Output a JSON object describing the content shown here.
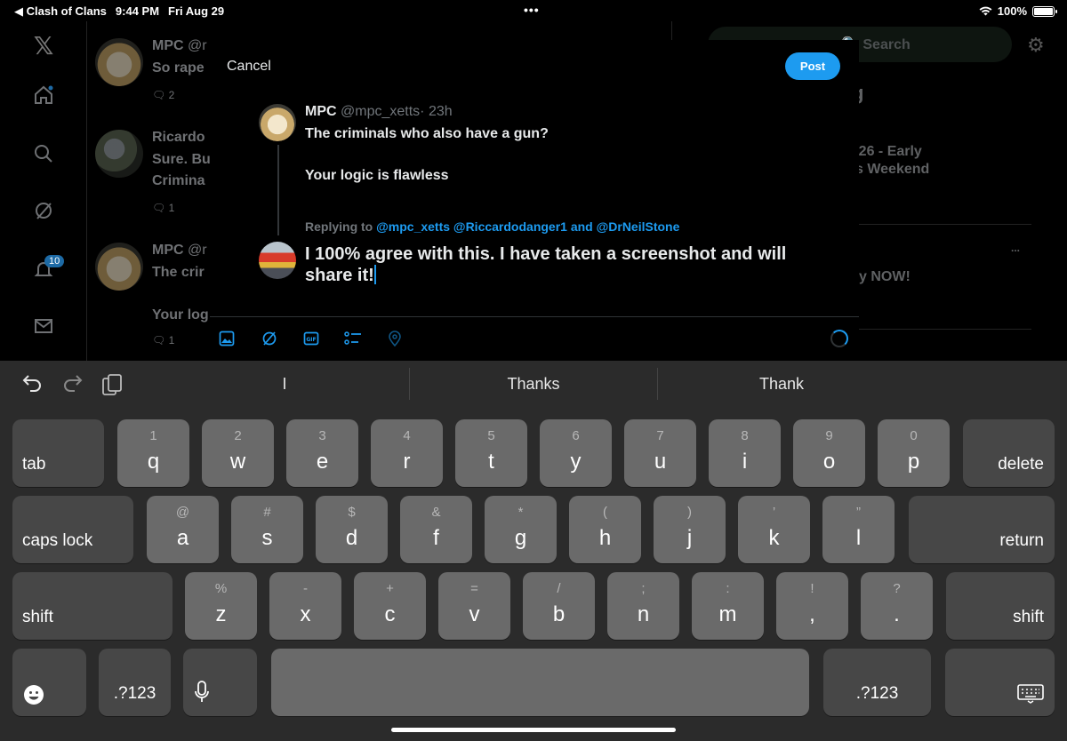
{
  "status_bar": {
    "back_app": "◀ Clash of Clans",
    "time": "9:44 PM",
    "date": "Fri Aug 29",
    "battery_percent": "100%",
    "battery_level": 1.0
  },
  "background": {
    "nav_badge": "10",
    "feed": [
      {
        "name": "MPC",
        "handle": "@r",
        "text": "So rape",
        "reply_count": "2"
      },
      {
        "name": "Ricardo",
        "text_lines": [
          "Sure. Bu",
          "Crimina"
        ],
        "reply_count": "1"
      },
      {
        "name": "MPC",
        "handle": "@r",
        "text_lines": [
          "The crir",
          "Your log"
        ],
        "reply_count": "1"
      }
    ],
    "search_placeholder": "Search",
    "right_snippets": [
      "g",
      "X26 - Early",
      "s Weekend",
      "y NOW!",
      "..."
    ]
  },
  "compose": {
    "cancel_label": "Cancel",
    "post_label": "Post",
    "original": {
      "name": "MPC",
      "handle": "@mpc_xetts",
      "time": "· 23h",
      "line1": "The criminals who also have a gun?",
      "line2": "Your logic is flawless"
    },
    "replying_to_label": "Replying to",
    "replying_to_mentions": "@mpc_xetts @Riccardodanger1 and @DrNeilStone",
    "draft_text": "I 100% agree with this.  I have taken a screenshot and will share it!",
    "toolbar_icons": [
      "image-icon",
      "gif-icon",
      "poll-icon",
      "location-icon",
      "grok-icon"
    ]
  },
  "keyboard": {
    "suggestions": [
      "I",
      "Thanks",
      "Thank"
    ],
    "row1": [
      {
        "sub": "1",
        "main": "q"
      },
      {
        "sub": "2",
        "main": "w"
      },
      {
        "sub": "3",
        "main": "e"
      },
      {
        "sub": "4",
        "main": "r"
      },
      {
        "sub": "5",
        "main": "t"
      },
      {
        "sub": "6",
        "main": "y"
      },
      {
        "sub": "7",
        "main": "u"
      },
      {
        "sub": "8",
        "main": "i"
      },
      {
        "sub": "9",
        "main": "o"
      },
      {
        "sub": "0",
        "main": "p"
      }
    ],
    "row2": [
      {
        "sub": "@",
        "main": "a"
      },
      {
        "sub": "#",
        "main": "s"
      },
      {
        "sub": "$",
        "main": "d"
      },
      {
        "sub": "&",
        "main": "f"
      },
      {
        "sub": "*",
        "main": "g"
      },
      {
        "sub": "(",
        "main": "h"
      },
      {
        "sub": ")",
        "main": "j"
      },
      {
        "sub": "’",
        "main": "k"
      },
      {
        "sub": "”",
        "main": "l"
      }
    ],
    "row3": [
      {
        "sub": "%",
        "main": "z"
      },
      {
        "sub": "-",
        "main": "x"
      },
      {
        "sub": "+",
        "main": "c"
      },
      {
        "sub": "=",
        "main": "v"
      },
      {
        "sub": "/",
        "main": "b"
      },
      {
        "sub": ";",
        "main": "n"
      },
      {
        "sub": ":",
        "main": "m"
      },
      {
        "sub": "!",
        "main": ","
      },
      {
        "sub": "?",
        "main": "."
      }
    ],
    "tab_label": "tab",
    "delete_label": "delete",
    "caps_label": "caps lock",
    "return_label": "return",
    "shift_label": "shift",
    "numbers_label": ".?123"
  }
}
